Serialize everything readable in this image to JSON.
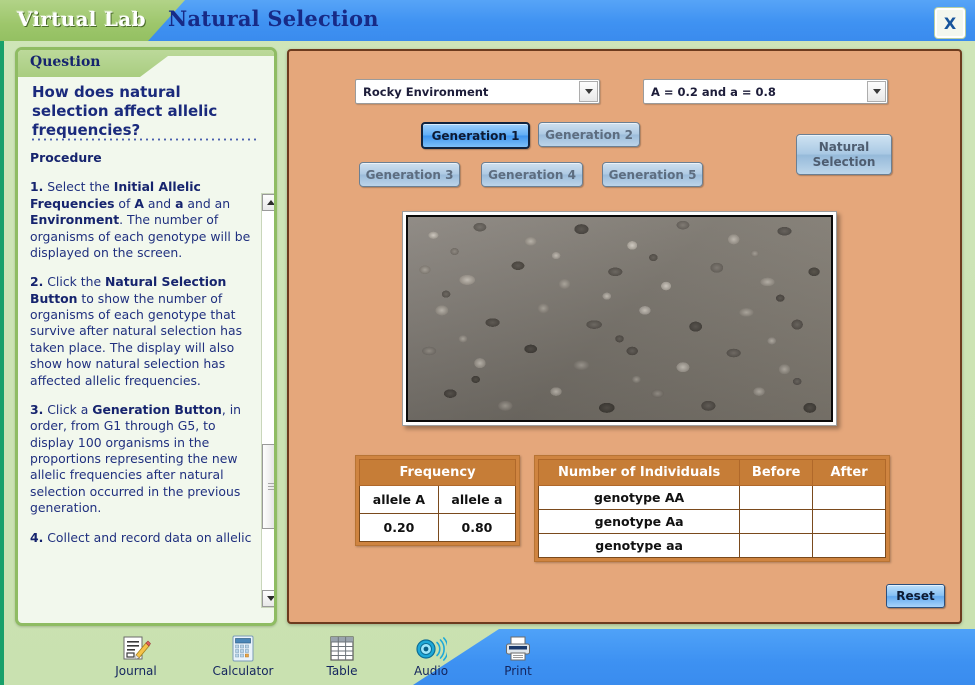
{
  "header": {
    "brand": "Virtual Lab",
    "title": "Natural Selection",
    "close_label": "X"
  },
  "question_panel": {
    "header_label": "Question",
    "question": "How does natural selection affect allelic frequencies?",
    "procedure_heading": "Procedure",
    "steps": [
      "1. Select the Initial Allelic Frequencies of A and a and an Environment. The number of organisms of each genotype will be displayed on the screen.",
      "2. Click the Natural Selection Button to show the number of organisms of each genotype that survive after natural selection has taken place. The display will also show how natural selection has affected allelic frequencies.",
      "3. Click a  Generation Button, in order, from G1 through G5, to display 100 organisms in the proportions representing the new allelic frequencies after natural selection occurred in the previous generation.",
      "4. Collect and record data on allelic"
    ]
  },
  "controls": {
    "environment_select": "Rocky Environment",
    "frequency_select": "A = 0.2 and a = 0.8",
    "generation_buttons": [
      "Generation 1",
      "Generation 2",
      "Generation 3",
      "Generation 4",
      "Generation 5"
    ],
    "active_generation": "Generation 1",
    "natural_selection_button": "Natural\nSelection",
    "natural_selection_line1": "Natural",
    "natural_selection_line2": "Selection",
    "reset_button": "Reset"
  },
  "habitat": {
    "name": "rocky-gravel-habitat"
  },
  "frequency_table": {
    "title": "Frequency",
    "columns": [
      "allele A",
      "allele a"
    ],
    "values": [
      "0.20",
      "0.80"
    ]
  },
  "individuals_table": {
    "columns": [
      "Number of Individuals",
      "Before",
      "After"
    ],
    "rows": [
      {
        "genotype": "genotype AA",
        "before": "",
        "after": ""
      },
      {
        "genotype": "genotype Aa",
        "before": "",
        "after": ""
      },
      {
        "genotype": "genotype aa",
        "before": "",
        "after": ""
      }
    ]
  },
  "toolbar": {
    "items": [
      {
        "label": "Journal",
        "icon": "journal-icon"
      },
      {
        "label": "Calculator",
        "icon": "calculator-icon"
      },
      {
        "label": "Table",
        "icon": "table-icon"
      },
      {
        "label": "Audio",
        "icon": "audio-icon"
      },
      {
        "label": "Print",
        "icon": "print-icon"
      }
    ]
  },
  "colors": {
    "page_bg": "#cce3b5",
    "header_blue": "#3f92f2",
    "header_green": "#9ac468",
    "panel_orange": "#e5a77b",
    "panel_border": "#6d3b1e",
    "table_header": "#c67d37",
    "title_navy": "#172a86",
    "toolbar_blue": "#3d91f2"
  }
}
